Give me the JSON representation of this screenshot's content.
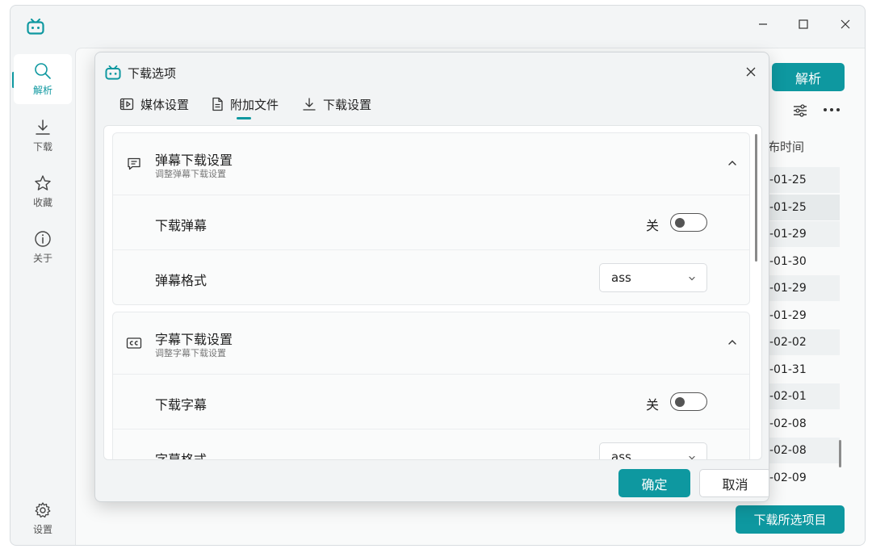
{
  "app": {
    "accent": "#0e98a0"
  },
  "sidebar": {
    "items": [
      {
        "label": "解析",
        "icon": "search-icon",
        "active": true
      },
      {
        "label": "下载",
        "icon": "download-icon"
      },
      {
        "label": "收藏",
        "icon": "star-icon"
      },
      {
        "label": "关于",
        "icon": "info-icon"
      }
    ],
    "settings": {
      "label": "设置",
      "icon": "gear-icon"
    }
  },
  "main": {
    "parse_button": "解析",
    "column_header": "布时间",
    "dates": [
      "-01-25",
      "-01-25",
      "-01-29",
      "-01-30",
      "-01-29",
      "-01-29",
      "-02-02",
      "-01-31",
      "-02-01",
      "-02-08",
      "-02-08",
      "-02-09"
    ],
    "download_selected_button": "下载所选项目"
  },
  "dialog": {
    "title": "下载选项",
    "tabs": [
      {
        "label": "媒体设置",
        "icon": "media-settings-icon"
      },
      {
        "label": "附加文件",
        "icon": "file-icon",
        "active": true
      },
      {
        "label": "下载设置",
        "icon": "download-icon"
      }
    ],
    "danmaku": {
      "title": "弹幕下载设置",
      "subtitle": "调整弹幕下载设置",
      "download_label": "下载弹幕",
      "toggle_state": "关",
      "format_label": "弹幕格式",
      "format_value": "ass"
    },
    "subtitles": {
      "title": "字幕下载设置",
      "subtitle": "调整字幕下载设置",
      "download_label": "下载字幕",
      "toggle_state": "关",
      "format_label": "字幕格式",
      "format_value": "ass"
    },
    "ok_button": "确定",
    "cancel_button": "取消"
  }
}
